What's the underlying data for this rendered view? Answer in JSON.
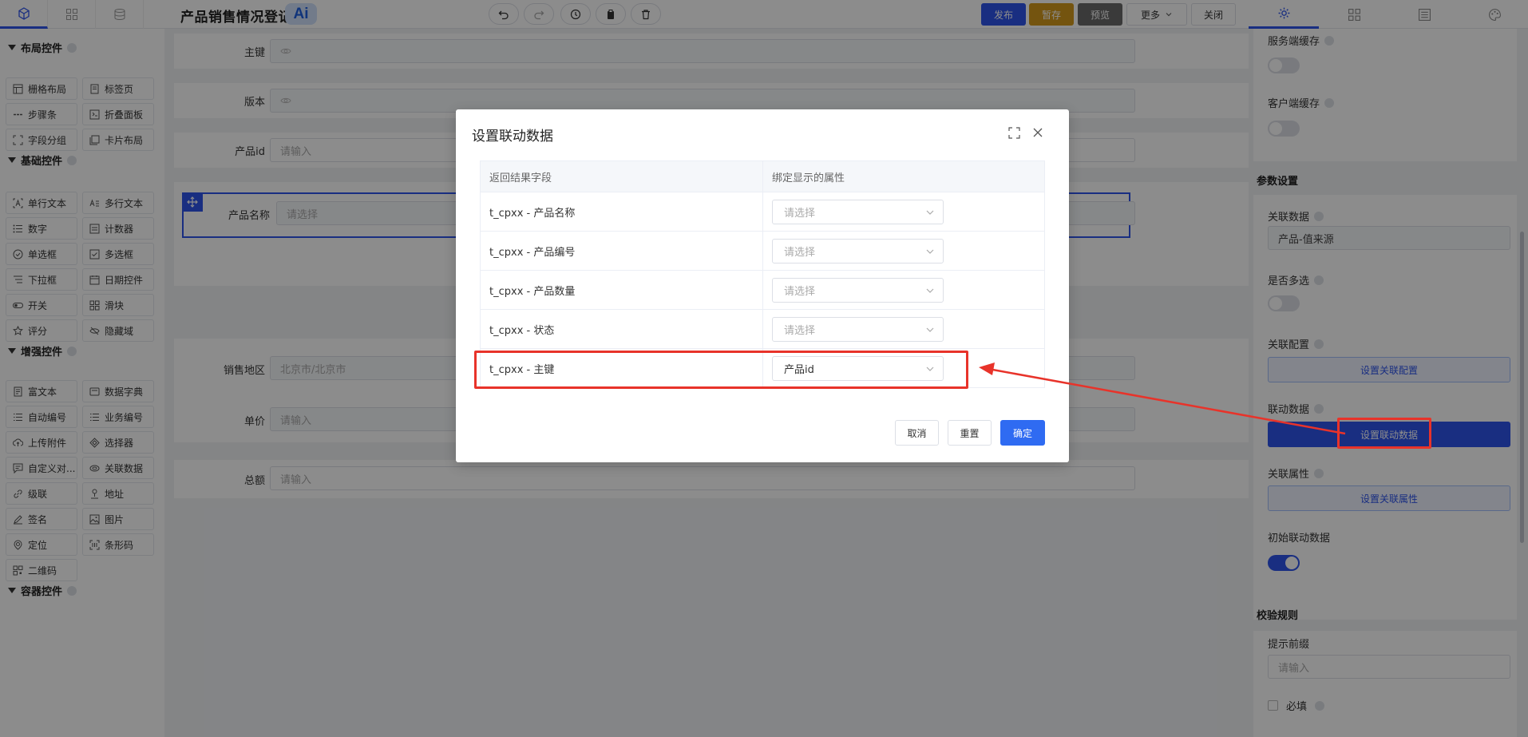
{
  "app": {
    "title": "产品销售情况登记",
    "ai_badge": "Ai"
  },
  "actions": {
    "publish": "发布",
    "save_draft": "暂存",
    "preview": "预览",
    "more": "更多",
    "close": "关闭"
  },
  "colors": {
    "primary": "#2f54eb",
    "warning": "#d49a1c",
    "preview": "#6b6b6b",
    "annotation": "#e8332a"
  },
  "palette": {
    "layout": {
      "title": "布局控件",
      "items": [
        "栅格布局",
        "标签页",
        "步骤条",
        "折叠面板",
        "字段分组",
        "卡片布局"
      ]
    },
    "basic": {
      "title": "基础控件",
      "items": [
        "单行文本",
        "多行文本",
        "数字",
        "计数器",
        "单选框",
        "多选框",
        "下拉框",
        "日期控件",
        "开关",
        "滑块",
        "评分",
        "隐藏域"
      ]
    },
    "enhanced": {
      "title": "增强控件",
      "items": [
        "富文本",
        "数据字典",
        "自动编号",
        "业务编号",
        "上传附件",
        "选择器",
        "自定义对...",
        "关联数据",
        "级联",
        "地址",
        "签名",
        "图片",
        "定位",
        "条形码",
        "二维码"
      ]
    },
    "container": {
      "title": "容器控件"
    }
  },
  "form": {
    "fields": [
      {
        "label": "主键",
        "placeholder": ""
      },
      {
        "label": "版本",
        "placeholder": ""
      },
      {
        "label": "产品id",
        "placeholder": "请输入"
      },
      {
        "label": "产品名称",
        "placeholder": "请选择"
      },
      {
        "label": "销售地区",
        "placeholder": "北京市/北京市"
      },
      {
        "label": "单价",
        "placeholder": "请输入"
      },
      {
        "label": "总额",
        "placeholder": "请输入"
      }
    ]
  },
  "right_panel": {
    "server_cache": "服务端缓存",
    "client_cache": "客户端缓存",
    "params_title": "参数设置",
    "related_data_label": "关联数据",
    "related_data_value": "产品-值来源",
    "multi_select": "是否多选",
    "related_config": "关联配置",
    "related_config_btn": "设置关联配置",
    "linkage_data": "联动数据",
    "linkage_data_btn": "设置联动数据",
    "related_attr": "关联属性",
    "related_attr_btn": "设置关联属性",
    "init_linkage": "初始联动数据",
    "validation_title": "校验规则",
    "hint_prefix": "提示前缀",
    "hint_placeholder": "请输入",
    "required": "必填"
  },
  "modal": {
    "title": "设置联动数据",
    "col_field": "返回结果字段",
    "col_attr": "绑定显示的属性",
    "rows": [
      {
        "field": "t_cpxx - 产品名称",
        "value": "",
        "placeholder": "请选择"
      },
      {
        "field": "t_cpxx - 产品编号",
        "value": "",
        "placeholder": "请选择"
      },
      {
        "field": "t_cpxx - 产品数量",
        "value": "",
        "placeholder": "请选择"
      },
      {
        "field": "t_cpxx - 状态",
        "value": "",
        "placeholder": "请选择"
      },
      {
        "field": "t_cpxx - 主键",
        "value": "产品id",
        "placeholder": "请选择"
      }
    ],
    "cancel": "取消",
    "reset": "重置",
    "confirm": "确定"
  }
}
